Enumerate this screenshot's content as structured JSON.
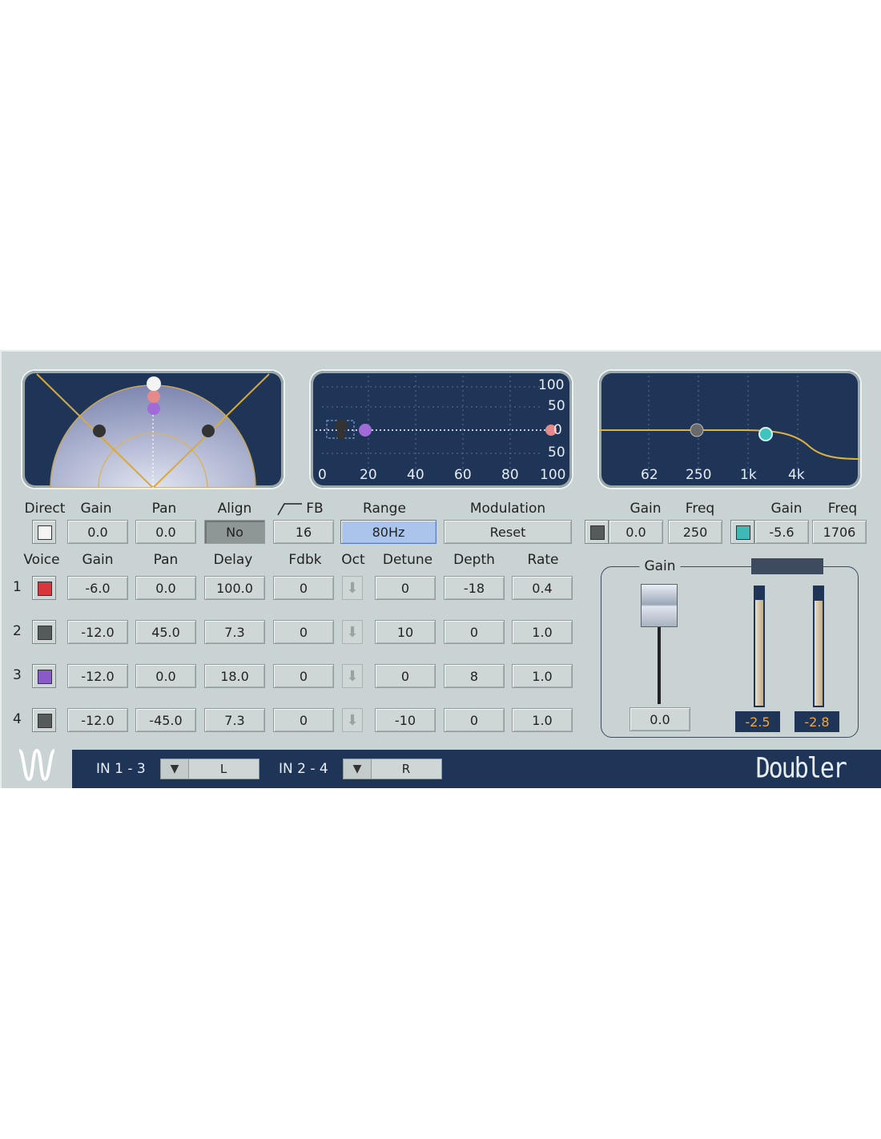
{
  "app": {
    "name": "Doubler"
  },
  "colors": {
    "panel": "#c9d3d3",
    "display": "#1f3558",
    "accent_line": "#e0b040",
    "meter_text": "#f0a83a",
    "range_active": "#aac4ec"
  },
  "pan_display": {
    "icon": "pan-arc-icon"
  },
  "delay_display": {
    "y_labels": [
      "100",
      "50",
      "0",
      "50",
      "100"
    ],
    "x_labels": [
      "0",
      "20",
      "40",
      "60",
      "80",
      "100"
    ]
  },
  "eq_display": {
    "x_labels": [
      "62",
      "250",
      "1k",
      "4k"
    ]
  },
  "top_controls": {
    "direct_label": "Direct",
    "gain_label": "Gain",
    "gain_value": "0.0",
    "pan_label": "Pan",
    "pan_value": "0.0",
    "align_label": "Align",
    "align_value": "No",
    "fb_label": "FB",
    "fb_value": "16",
    "range_label": "Range",
    "range_value": "80Hz",
    "modulation_label": "Modulation",
    "reset_label": "Reset"
  },
  "eq_controls": {
    "low_gain_label": "Gain",
    "low_gain_value": "0.0",
    "low_freq_label": "Freq",
    "low_freq_value": "250",
    "high_gain_label": "Gain",
    "high_gain_value": "-5.6",
    "high_freq_label": "Freq",
    "high_freq_value": "1706"
  },
  "voice_table": {
    "headers": [
      "Voice",
      "Gain",
      "Pan",
      "Delay",
      "Fdbk",
      "Oct",
      "Detune",
      "Depth",
      "Rate"
    ],
    "rows": [
      {
        "num": "1",
        "color": "#d8363c",
        "gain": "-6.0",
        "pan": "0.0",
        "delay": "100.0",
        "fdbk": "0",
        "detune": "0",
        "depth": "-18",
        "rate": "0.4"
      },
      {
        "num": "2",
        "color": "#555a5a",
        "gain": "-12.0",
        "pan": "45.0",
        "delay": "7.3",
        "fdbk": "0",
        "detune": "10",
        "depth": "0",
        "rate": "1.0"
      },
      {
        "num": "3",
        "color": "#8a5ac8",
        "gain": "-12.0",
        "pan": "0.0",
        "delay": "18.0",
        "fdbk": "0",
        "detune": "0",
        "depth": "8",
        "rate": "1.0"
      },
      {
        "num": "4",
        "color": "#555a5a",
        "gain": "-12.0",
        "pan": "-45.0",
        "delay": "7.3",
        "fdbk": "0",
        "detune": "-10",
        "depth": "0",
        "rate": "1.0"
      }
    ]
  },
  "output": {
    "gain_label": "Gain",
    "gain_value": "0.0",
    "meter_left": "-2.5",
    "meter_right": "-2.8",
    "meter_left_level": 0.87,
    "meter_right_level": 0.86
  },
  "bottom_bar": {
    "in1_label": "IN 1 - 3",
    "in1_value": "L",
    "in2_label": "IN 2 - 4",
    "in2_value": "R",
    "logo_icon": "waves-logo-icon"
  }
}
